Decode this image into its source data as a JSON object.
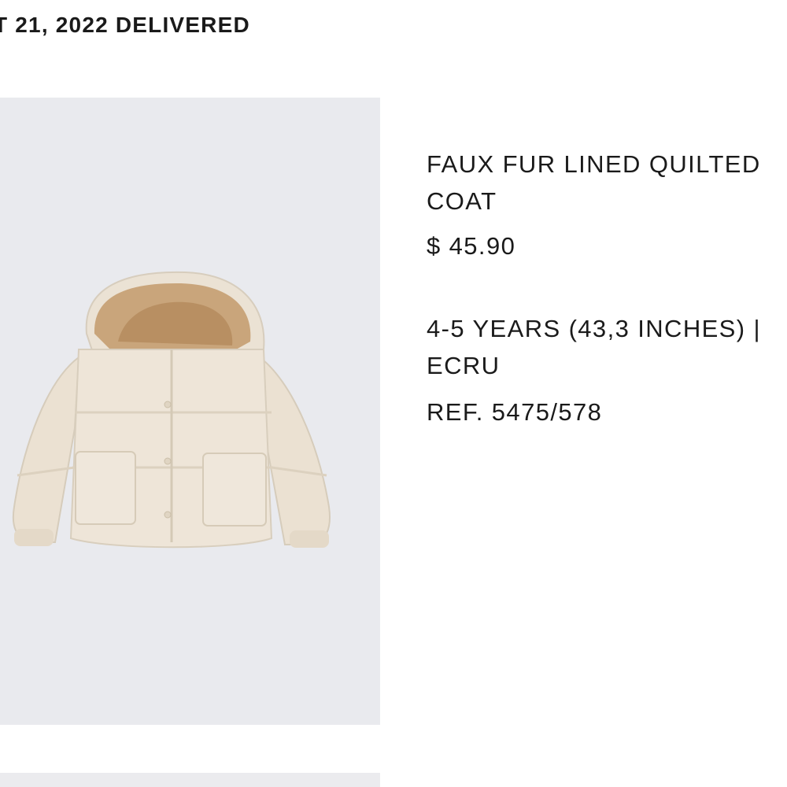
{
  "order": {
    "status_text": "T 21, 2022 DELIVERED"
  },
  "product": {
    "name": "FAUX FUR LINED QUILTED COAT",
    "price": "$ 45.90",
    "variant": "4-5 YEARS (43,3 INCHES) | ECRU",
    "reference": "REF. 5475/578",
    "image_alt": "faux fur lined quilted coat photo",
    "colors": {
      "background": "#e9eaee",
      "coat": "#ece2d3",
      "fur": "#c9a57b"
    }
  }
}
